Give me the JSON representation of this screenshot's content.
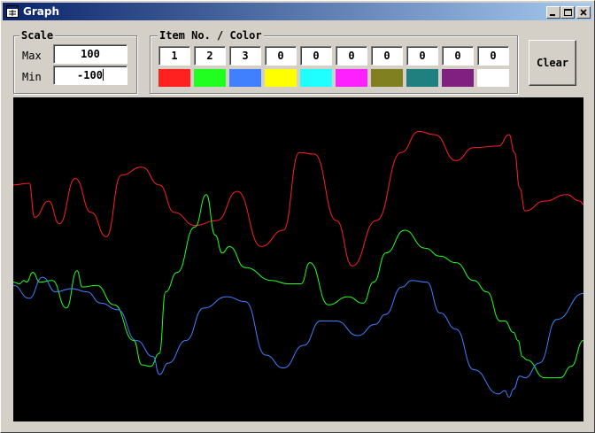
{
  "window": {
    "title": "Graph"
  },
  "scale": {
    "legend": "Scale",
    "max_label": "Max",
    "max_value": "100",
    "min_label": "Min",
    "min_value": "-100"
  },
  "items": {
    "legend": "Item No. / Color",
    "numbers": [
      "1",
      "2",
      "3",
      "0",
      "0",
      "0",
      "0",
      "0",
      "0",
      "0"
    ],
    "colors": [
      "#ff2020",
      "#20ff20",
      "#4080ff",
      "#ffff00",
      "#20ffff",
      "#ff20ff",
      "#808020",
      "#208080",
      "#802080",
      "#ffffff"
    ]
  },
  "clear_label": "Clear",
  "chart_data": {
    "type": "line",
    "ylim": [
      -100,
      100
    ],
    "series": [
      {
        "color": "#ff2020",
        "x": [
          0,
          18,
          24,
          40,
          52,
          70,
          88,
          105,
          122,
          145,
          165,
          182,
          205,
          230,
          253,
          280,
          305,
          323,
          340,
          365,
          383,
          410,
          438,
          458,
          476,
          500,
          520,
          548,
          560,
          566,
          572,
          578,
          600,
          625,
          640,
          644
        ],
        "values": [
          46,
          47,
          26,
          36,
          22,
          50,
          29,
          14,
          52,
          57,
          46,
          29,
          21,
          24,
          42,
          8,
          18,
          66,
          65,
          24,
          -4,
          24,
          66,
          79,
          77,
          61,
          69,
          70,
          77,
          66,
          44,
          30,
          36,
          40,
          36,
          34
        ]
      },
      {
        "color": "#20ff20",
        "x": [
          0,
          7,
          12,
          15,
          22,
          30,
          44,
          60,
          72,
          78,
          94,
          114,
          136,
          145,
          155,
          165,
          172,
          185,
          205,
          218,
          228,
          236,
          244,
          262,
          292,
          310,
          325,
          335,
          356,
          378,
          395,
          407,
          421,
          442,
          465,
          482,
          500,
          520,
          535,
          550,
          555,
          565,
          570,
          575,
          580,
          600,
          618,
          630,
          644
        ],
        "values": [
          -14,
          -15,
          -13,
          -14,
          -8,
          -14,
          -13,
          -30,
          -7,
          -17,
          -16,
          -28,
          -50,
          -65,
          -66,
          -58,
          -20,
          -8,
          20,
          40,
          15,
          4,
          8,
          -5,
          -13,
          -15,
          -15,
          -2,
          -28,
          -23,
          -27,
          -14,
          4,
          18,
          7,
          2,
          -2,
          -13,
          -20,
          -38,
          -38,
          -45,
          -50,
          -60,
          -62,
          -73,
          -73,
          -66,
          -50
        ]
      },
      {
        "color": "#4080ff",
        "x": [
          0,
          18,
          33,
          48,
          66,
          83,
          99,
          118,
          139,
          158,
          165,
          175,
          195,
          215,
          241,
          262,
          285,
          305,
          328,
          347,
          365,
          389,
          409,
          420,
          439,
          450,
          467,
          482,
          500,
          520,
          548,
          555,
          560,
          565,
          572,
          578,
          594,
          614,
          644
        ],
        "values": [
          -16,
          -24,
          -11,
          -20,
          -18,
          -20,
          -27,
          -31,
          -50,
          -60,
          -71,
          -64,
          -50,
          -30,
          -23,
          -26,
          -59,
          -67,
          -53,
          -38,
          -38,
          -47,
          -40,
          -34,
          -17,
          -13,
          -14,
          -33,
          -43,
          -68,
          -83,
          -81,
          -85,
          -80,
          -72,
          -73,
          -64,
          -37,
          -21
        ]
      }
    ]
  }
}
